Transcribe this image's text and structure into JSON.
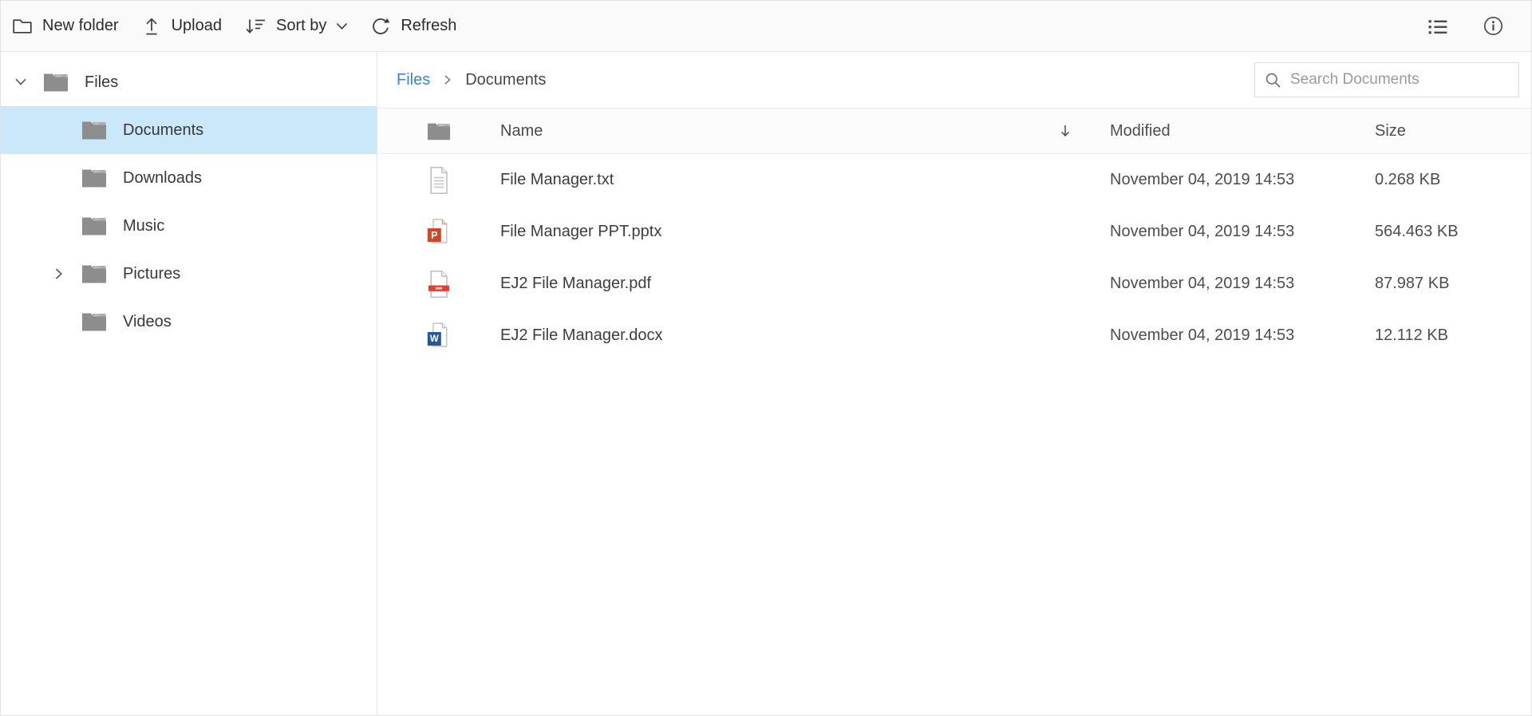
{
  "toolbar": {
    "buttons": [
      {
        "label": "New folder",
        "icon": "new-folder-icon"
      },
      {
        "label": "Upload",
        "icon": "upload-icon"
      },
      {
        "label": "Sort by",
        "icon": "sort-icon",
        "has_dropdown": true
      },
      {
        "label": "Refresh",
        "icon": "refresh-icon"
      }
    ],
    "right_icons": [
      "details-view-icon",
      "info-icon"
    ]
  },
  "sidebar": {
    "items": [
      {
        "label": "Files",
        "level": 0,
        "expanded": true,
        "selected": false
      },
      {
        "label": "Documents",
        "level": 1,
        "selected": true
      },
      {
        "label": "Downloads",
        "level": 1,
        "selected": false
      },
      {
        "label": "Music",
        "level": 1,
        "selected": false
      },
      {
        "label": "Pictures",
        "level": 1,
        "selected": false,
        "collapsed_expander": true
      },
      {
        "label": "Videos",
        "level": 1,
        "selected": false
      }
    ]
  },
  "breadcrumb": {
    "root": "Files",
    "separator": ">",
    "current": "Documents"
  },
  "search": {
    "placeholder": "Search Documents",
    "value": ""
  },
  "grid": {
    "columns": {
      "name": "Name",
      "modified": "Modified",
      "size": "Size"
    },
    "sorted_column": "Name",
    "sort_icon": "arrow-down",
    "rows": [
      {
        "name": "File Manager.txt",
        "type": "txt",
        "modified": "November 04, 2019 14:53",
        "size": "0.268 KB"
      },
      {
        "name": "File Manager PPT.pptx",
        "type": "pptx",
        "modified": "November 04, 2019 14:53",
        "size": "564.463 KB"
      },
      {
        "name": "EJ2 File Manager.pdf",
        "type": "pdf",
        "modified": "November 04, 2019 14:53",
        "size": "87.987 KB"
      },
      {
        "name": "EJ2 File Manager.docx",
        "type": "docx",
        "modified": "November 04, 2019 14:53",
        "size": "12.112 KB"
      }
    ]
  },
  "colors": {
    "accent_link": "#3a82d6",
    "selection_bg": "#cbe8fa",
    "folder_gray": "#8d8d8d",
    "powerpoint_orange": "#d04727",
    "word_blue": "#2b579a",
    "pdf_red": "#e2402e"
  }
}
